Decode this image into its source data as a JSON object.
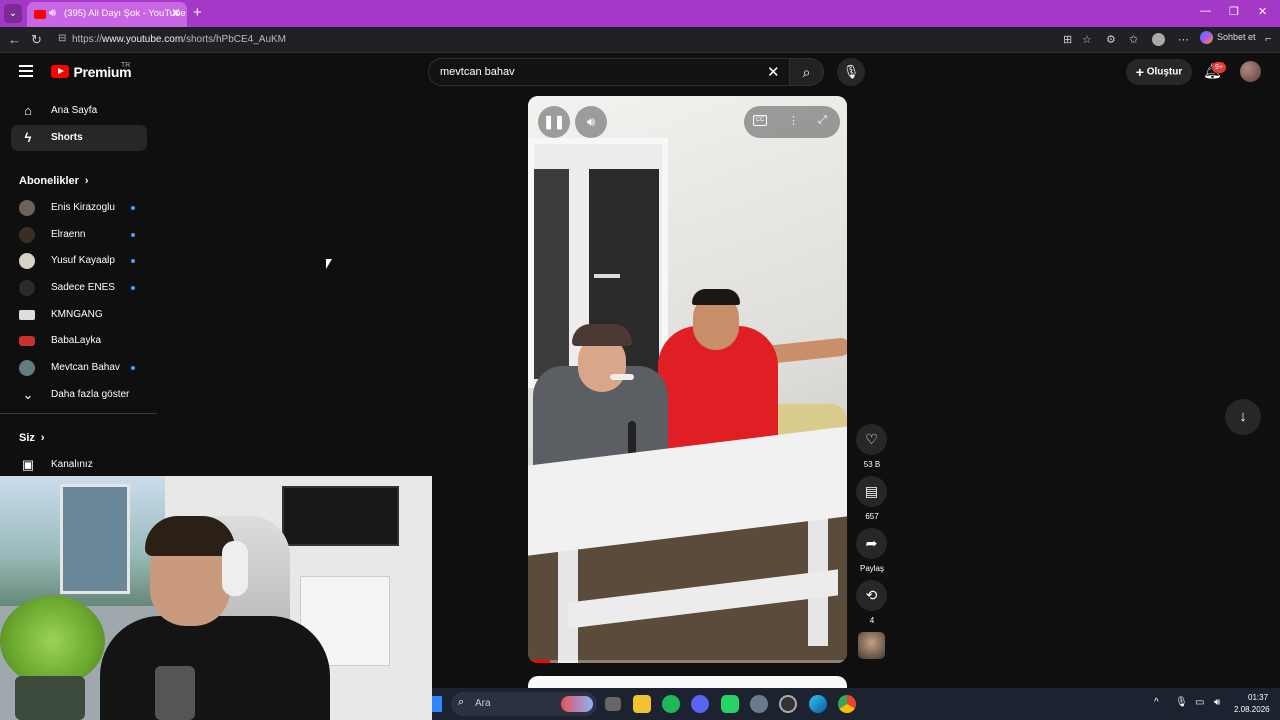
{
  "browser": {
    "tab_title": "(395) Ali Dayı Şok - YouTube",
    "url_prefix": "https://",
    "url_host": "www.youtube.com",
    "url_path": "/shorts/hPbCE4_AuKM",
    "copilot_label": "Sohbet et"
  },
  "header": {
    "logo_text": "Premium",
    "region": "TR",
    "search_value": "mevtcan bahav",
    "create_label": "Oluştur",
    "notification_badge": "9+"
  },
  "sidebar": {
    "items": [
      {
        "label": "Ana Sayfa"
      },
      {
        "label": "Shorts"
      }
    ],
    "subscriptions_heading": "Abonelikler",
    "subscriptions": [
      {
        "label": "Enis Kirazoglu"
      },
      {
        "label": "Elraenn"
      },
      {
        "label": "Yusuf Kayaalp"
      },
      {
        "label": "Sadece ENES"
      },
      {
        "label": "KMNGANG"
      },
      {
        "label": "BabaLayka"
      },
      {
        "label": "Mevtcan Bahav"
      }
    ],
    "show_more": "Daha fazla göster",
    "you_heading": "Siz",
    "channel_label": "Kanalınız"
  },
  "player": {
    "progress": 0.07
  },
  "actions": {
    "likes": "53 B",
    "comments": "657",
    "share": "Paylaş",
    "remix": "4"
  },
  "taskbar": {
    "search_placeholder": "Ara",
    "time": "01:37",
    "date": "2.08.2026"
  },
  "colors": {
    "accent": "#ff0000",
    "tab_bar": "#a539c7",
    "subscription_dot": "#3ea6ff"
  }
}
